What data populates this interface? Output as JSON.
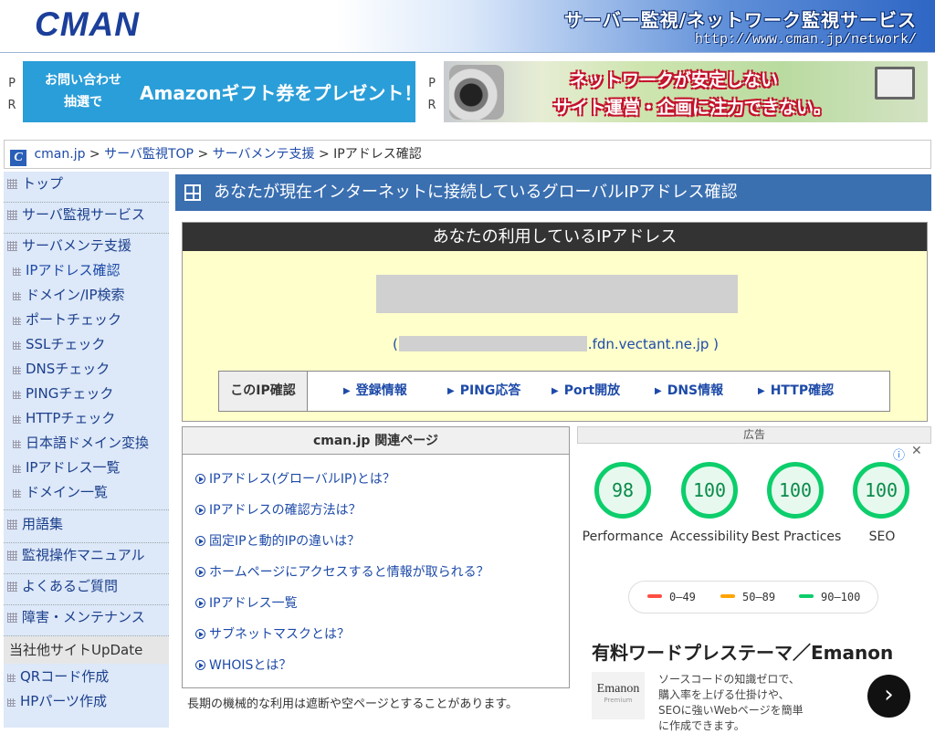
{
  "header": {
    "logo": "CMAN",
    "service_title": "サーバー監視/ネットワーク監視サービス",
    "service_url": "http://www.cman.jp/network/"
  },
  "promo": {
    "pr_label_1": "P",
    "pr_label_2": "R",
    "ad1": {
      "line1": "お問い合わせ",
      "line2": "抽選で",
      "main": "Amazonギフト券をプレゼント！",
      "color": "#2a9ed8"
    },
    "ad2": {
      "line1": "ネットワークが安定しない",
      "line2": "サイト運営・企画に注力できない。"
    }
  },
  "breadcrumb": {
    "icon": "C",
    "items": [
      "cman.jp",
      "サーバ監視TOP",
      "サーバメンテ支援",
      "IPアドレス確認"
    ],
    "separator": ">"
  },
  "sidebar": {
    "items": [
      {
        "label": "トップ"
      },
      {
        "label": "サーバ監視サービス"
      },
      {
        "label": "サーバメンテ支援"
      },
      {
        "label": "IPアドレス確認"
      },
      {
        "label": "ドメイン/IP検索"
      },
      {
        "label": "ポートチェック"
      },
      {
        "label": "SSLチェック"
      },
      {
        "label": "DNSチェック"
      },
      {
        "label": "PINGチェック"
      },
      {
        "label": "HTTPチェック"
      },
      {
        "label": "日本語ドメイン変換"
      },
      {
        "label": "IPアドレス一覧"
      },
      {
        "label": "ドメイン一覧"
      },
      {
        "label": "用語集"
      },
      {
        "label": "監視操作マニュアル"
      },
      {
        "label": "よくあるご質問"
      },
      {
        "label": "障害・メンテナンス"
      }
    ],
    "section_title": "当社他サイトUpDate",
    "other_sites": [
      {
        "label": "QRコード作成"
      },
      {
        "label": "HPパーツ作成"
      }
    ]
  },
  "main": {
    "title": "あなたが現在インターネットに接続しているグローバルIPアドレス確認",
    "ip_box": {
      "title": "あなたの利用しているIPアドレス",
      "host_prefix": "(",
      "host_suffix": ".fdn.vectant.ne.jp )",
      "check_label": "このIP確認",
      "checks": [
        "登録情報",
        "PING応答",
        "Port開放",
        "DNS情報",
        "HTTP確認"
      ]
    },
    "related": {
      "title": "cman.jp 関連ページ",
      "links": [
        "IPアドレス(グローバルIP)とは？",
        "IPアドレスの確認方法は？",
        "固定IPと動的IPの違いは？",
        "ホームページにアクセスすると情報が取られる？",
        "IPアドレス一覧",
        "サブネットマスクとは？",
        "WHOISとは？"
      ]
    },
    "notice": "長期の機械的な利用は遮断や空ページとすることがあります。"
  },
  "ad": {
    "label": "広告",
    "info_icon": "ⓘ",
    "close_icon": "✕",
    "scores": [
      {
        "value": "98",
        "label": "Performance"
      },
      {
        "value": "100",
        "label": "Accessibility"
      },
      {
        "value": "100",
        "label": "Best Practices"
      },
      {
        "value": "100",
        "label": "SEO"
      }
    ],
    "legend": [
      {
        "range": "0–49",
        "color": "#ff4e42"
      },
      {
        "range": "50–89",
        "color": "#ffa400"
      },
      {
        "range": "90–100",
        "color": "#0cce6b"
      }
    ],
    "headline": "有料ワードプレステーマ／Emanon",
    "logo_name": "Emanon",
    "logo_sub": "Premium",
    "description": "ソースコードの知識ゼロで、購入率を上げる仕掛けや、SEOに強いWebページを簡単に作成できます。",
    "arrow": "›"
  }
}
